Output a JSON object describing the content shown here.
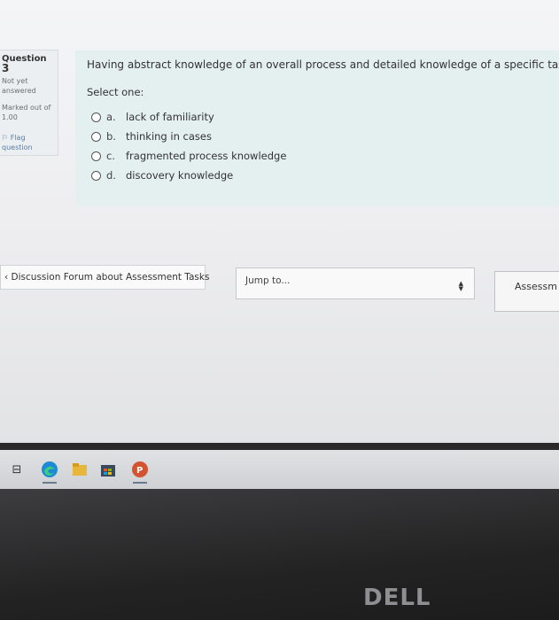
{
  "question_info": {
    "label": "Question",
    "number": "3",
    "state": "Not yet answered",
    "marked_out_of": "Marked out of 1.00",
    "flag_label": "Flag question"
  },
  "question": {
    "text": "Having abstract knowledge of an overall process and detailed knowledge of a specific task, is known",
    "prompt": "Select one:",
    "answers": [
      {
        "letter": "a.",
        "text": "lack of familiarity"
      },
      {
        "letter": "b.",
        "text": "thinking in cases"
      },
      {
        "letter": "c.",
        "text": "fragmented process knowledge"
      },
      {
        "letter": "d.",
        "text": "discovery knowledge"
      }
    ]
  },
  "navigation": {
    "prev_link": "Discussion Forum about Assessment Tasks",
    "jump_placeholder": "Jump to...",
    "next_link": "Assessm"
  },
  "taskbar": {
    "icons": [
      "task-view-icon",
      "edge-icon",
      "file-explorer-icon",
      "store-icon",
      "powerpoint-icon"
    ]
  },
  "brand": "DELL",
  "colors": {
    "question_bg": "#e4eff0",
    "info_bg": "#eceff1",
    "flag_color": "#5a7ca3"
  }
}
